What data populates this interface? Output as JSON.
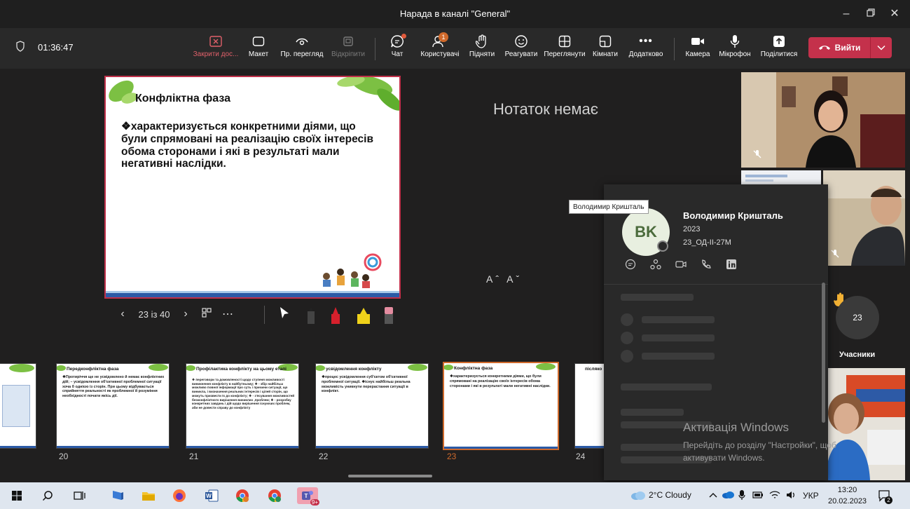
{
  "window": {
    "title": "Нарада в каналі \"General\""
  },
  "toolbar": {
    "timer": "01:36:47",
    "items": [
      {
        "label": "Закрити дос..."
      },
      {
        "label": "Макет"
      },
      {
        "label": "Пр. перегляд"
      },
      {
        "label": "Відкріпити"
      },
      {
        "label": "Чат"
      },
      {
        "label": "Користувачі",
        "badge": "1"
      },
      {
        "label": "Підняти"
      },
      {
        "label": "Реагувати"
      },
      {
        "label": "Переглянути"
      },
      {
        "label": "Кімнати"
      },
      {
        "label": "Додатково"
      },
      {
        "label": "Камера"
      },
      {
        "label": "Мікрофон"
      },
      {
        "label": "Поділитися"
      }
    ],
    "leave_label": "Вийти",
    "colors": {
      "leave": "#c4314b",
      "accent": "#d06a2c"
    }
  },
  "slide": {
    "title": "Конфліктна фаза",
    "body": "❖характеризується конкретними діями, що були спрямовані на реалізацію своїх інтересів обома сторонами і які в результаті мали негативні наслідки."
  },
  "slide_controls": {
    "counter": "23 із 40",
    "more": "⋯"
  },
  "notes": {
    "empty_text": "Нотаток немає",
    "font_controls": "Aˆ Aˇ"
  },
  "thumbnails": [
    {
      "num": "20",
      "title": "Передконфліктна фаза",
      "body": "❖Протиріччя ще не усвідомлено й немає конфліктних дій; – усвідомлення об'єктивної проблемної ситуації хоча б однією із сторін. При цьому відбувається сприйняття реальності як проблемної й розуміння необхідності почати якісь дії."
    },
    {
      "num": "21",
      "title": "Профілактика конфлікту на цьому етапі",
      "body": "❖ переговори та домовленості щодо ступеня можливості виникнення конфлікту в найбутньому; ❖ - збір найбільш можливо повної інформації про суть і причини ситуації, що виникла, і визначення реальних інтересів і цілей сторін, що можуть призвести їх до конфлікту; ❖ - з'ясування можливостей безконфліктного вирішення виниклих ,проблем; ❖ - розробку конкретних завдань і дій щодо вирішення існуючих проблем, аби не довести справу до конфлікту"
    },
    {
      "num": "22",
      "title": "усвідомлення конфлікту",
      "body": "❖процес усвідомлення суб'єктом об'єктивної проблемної ситуації. ❖існує найбільш реальна можливість уникнути перерастання ситуації в конфлікт."
    },
    {
      "num": "23",
      "title": "Конфліктна фаза",
      "body": "❖характеризується конкретними діями, що були спрямовані на реалізацію своїх інтересів обома сторонами і які в результаті мали негативні наслідки."
    },
    {
      "num": "24",
      "title": "післяко",
      "body": ""
    }
  ],
  "profile_card": {
    "tooltip": "Володимир Кришталь",
    "initials": "BK",
    "name": "Володимир Кришталь",
    "line1": "2023",
    "line2": "23_ОД-ІІ-27М"
  },
  "participants": {
    "count": "23",
    "label": "Учасники"
  },
  "activation": {
    "title": "Активація Windows",
    "text": "Перейдіть до розділу \"Настройки\", щоб активувати Windows."
  },
  "taskbar": {
    "teams_badge": "9+",
    "weather": "2°C  Cloudy",
    "lang": "УКР",
    "time": "13:20",
    "date": "20.02.2023",
    "notif_count": "2"
  }
}
